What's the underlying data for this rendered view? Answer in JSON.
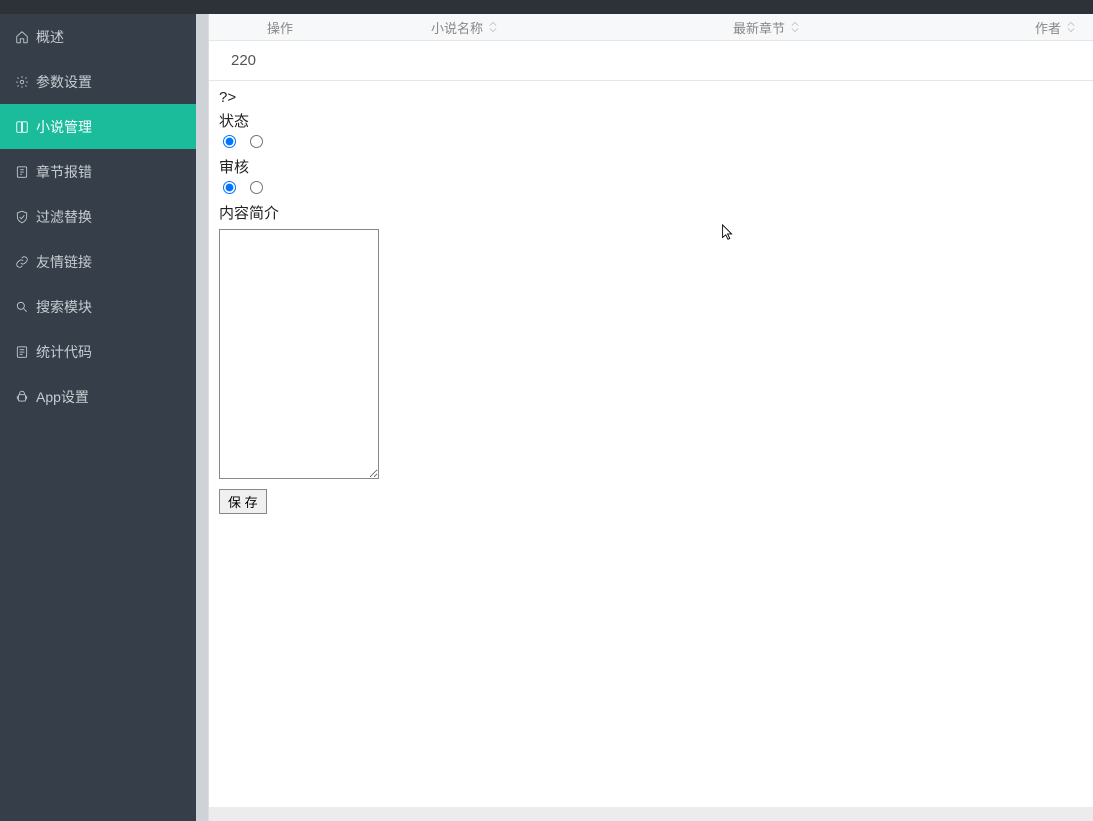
{
  "sidebar": {
    "items": [
      {
        "label": "概述",
        "icon": "home-icon"
      },
      {
        "label": "参数设置",
        "icon": "gear-icon"
      },
      {
        "label": "小说管理",
        "icon": "book-icon",
        "active": true
      },
      {
        "label": "章节报错",
        "icon": "alert-icon"
      },
      {
        "label": "过滤替换",
        "icon": "shield-icon"
      },
      {
        "label": "友情链接",
        "icon": "link-icon"
      },
      {
        "label": "搜索模块",
        "icon": "search-icon"
      },
      {
        "label": "统计代码",
        "icon": "chart-icon"
      },
      {
        "label": "App设置",
        "icon": "android-icon"
      }
    ]
  },
  "table": {
    "columns": {
      "ops": "操作",
      "name": "小说名称",
      "latest": "最新章节",
      "author": "作者"
    },
    "row_number": "220"
  },
  "form": {
    "raw_text": "?>",
    "status_label": "状态",
    "audit_label": "审核",
    "synopsis_label": "内容简介",
    "synopsis_value": "",
    "save_label": "保 存"
  }
}
